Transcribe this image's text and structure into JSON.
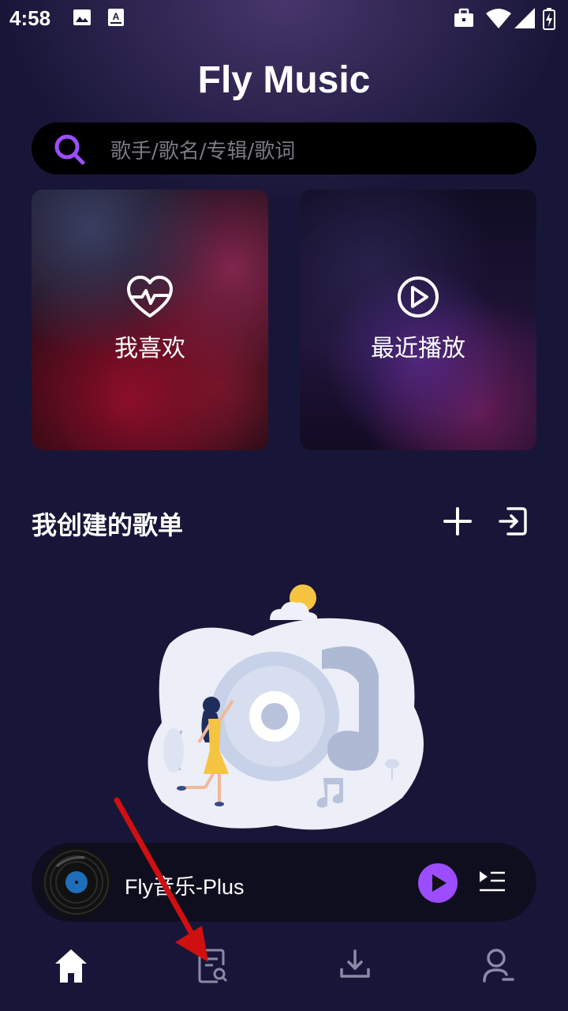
{
  "status_bar": {
    "time": "4:58",
    "icons": [
      "image-icon",
      "a-icon",
      "briefcase-icon",
      "wifi-icon",
      "signal-icon",
      "battery-icon"
    ]
  },
  "header": {
    "title": "Fly Music"
  },
  "search": {
    "placeholder": "歌手/歌名/专辑/歌词",
    "icon": "search-icon"
  },
  "cards": [
    {
      "label": "我喜欢",
      "icon": "heart-pulse-icon"
    },
    {
      "label": "最近播放",
      "icon": "play-circle-icon"
    }
  ],
  "playlists": {
    "title": "我创建的歌单",
    "actions": [
      "plus-icon",
      "import-icon"
    ]
  },
  "player": {
    "title": "Fly音乐-Plus",
    "icons": [
      "disc-icon",
      "play-icon",
      "queue-icon"
    ]
  },
  "bottom_nav": {
    "items": [
      "home-icon",
      "search-list-icon",
      "download-icon",
      "user-icon"
    ],
    "active": "home-icon"
  },
  "colors": {
    "background": "#181638",
    "accent": "#9b4dff",
    "search_bg": "#000000",
    "annotation_arrow": "#d01010"
  }
}
